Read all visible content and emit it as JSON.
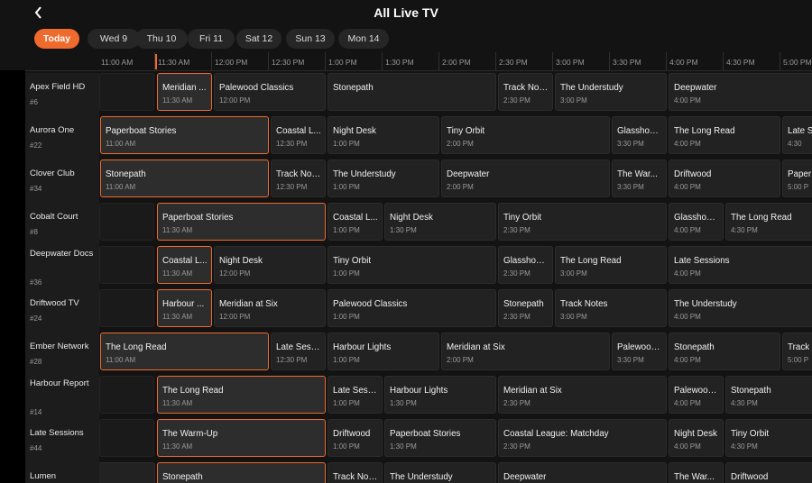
{
  "header": {
    "title": "All Live TV",
    "back_icon": "chevron-left-icon"
  },
  "days": [
    "Today",
    "Wed 9",
    "Thu 10",
    "Fri 11",
    "Sat 12",
    "Sun 13",
    "Mon 14"
  ],
  "timeline": [
    "11:00 AM",
    "11:30 AM",
    "12:00 PM",
    "12:30 PM",
    "1:00 PM",
    "1:30 PM",
    "2:00 PM",
    "2:30 PM",
    "3:00 PM",
    "3:30 PM",
    "4:00 PM",
    "4:30 PM",
    "5:00 PM"
  ],
  "accent_color": "#ee6a2d",
  "channels": [
    {
      "name": "Apex Field HD",
      "number": "#6",
      "programs": [
        {
          "title": "Meridian ...",
          "time": "11:30 AM",
          "live": true
        },
        {
          "title": "Palewood Classics",
          "time": "12:00 PM"
        },
        {
          "title": "Stonepath",
          "time": ""
        },
        {
          "title": "Track Not...",
          "time": "2:30 PM"
        },
        {
          "title": "The Understudy",
          "time": "3:00 PM"
        },
        {
          "title": "Deepwater",
          "time": "4:00 PM"
        }
      ]
    },
    {
      "name": "Aurora One",
      "number": "#22",
      "programs": [
        {
          "title": "Paperboat Stories",
          "time": "11:00 AM",
          "live": true
        },
        {
          "title": "Coastal L...",
          "time": "12:30 PM"
        },
        {
          "title": "Night Desk",
          "time": "1:00 PM"
        },
        {
          "title": "Tiny Orbit",
          "time": "2:00 PM"
        },
        {
          "title": "Glasshouse",
          "time": "3:30 PM"
        },
        {
          "title": "The Long Read",
          "time": "4:00 PM"
        },
        {
          "title": "Late S",
          "time": "4:30"
        }
      ]
    },
    {
      "name": "Clover Club",
      "number": "#34",
      "programs": [
        {
          "title": "Stonepath",
          "time": "11:00 AM",
          "live": true
        },
        {
          "title": "Track Not...",
          "time": "12:30 PM"
        },
        {
          "title": "The Understudy",
          "time": "1:00 PM"
        },
        {
          "title": "Deepwater",
          "time": "2:00 PM"
        },
        {
          "title": "The War...",
          "time": "3:30 PM"
        },
        {
          "title": "Driftwood",
          "time": "4:00 PM"
        },
        {
          "title": "Paper",
          "time": "5:00 P"
        }
      ]
    },
    {
      "name": "Cobalt Court",
      "number": "#8",
      "programs": [
        {
          "title": "Paperboat Stories",
          "time": "11:30 AM",
          "live": true
        },
        {
          "title": "Coastal L...",
          "time": "1:00 PM"
        },
        {
          "title": "Night Desk",
          "time": "1:30 PM"
        },
        {
          "title": "Tiny Orbit",
          "time": "2:30 PM"
        },
        {
          "title": "Glasshouse",
          "time": "4:00 PM"
        },
        {
          "title": "The Long Read",
          "time": "4:30 PM"
        }
      ]
    },
    {
      "name": "Deepwater Docs",
      "number": "#36",
      "programs": [
        {
          "title": "Coastal L...",
          "time": "11:30 AM",
          "live": true
        },
        {
          "title": "Night Desk",
          "time": "12:00 PM"
        },
        {
          "title": "Tiny Orbit",
          "time": "1:00 PM"
        },
        {
          "title": "Glasshouse",
          "time": "2:30 PM"
        },
        {
          "title": "The Long Read",
          "time": "3:00 PM"
        },
        {
          "title": "Late Sessions",
          "time": "4:00 PM"
        }
      ]
    },
    {
      "name": "Driftwood TV",
      "number": "#24",
      "programs": [
        {
          "title": "Harbour ...",
          "time": "11:30 AM",
          "live": true
        },
        {
          "title": "Meridian at Six",
          "time": "12:00 PM"
        },
        {
          "title": "Palewood Classics",
          "time": "1:00 PM"
        },
        {
          "title": "Stonepath",
          "time": "2:30 PM"
        },
        {
          "title": "Track Notes",
          "time": "3:00 PM"
        },
        {
          "title": "The Understudy",
          "time": "4:00 PM"
        }
      ]
    },
    {
      "name": "Ember Network",
      "number": "#28",
      "programs": [
        {
          "title": "The Long Read",
          "time": "11:00 AM",
          "live": true
        },
        {
          "title": "Late Sess...",
          "time": "12:30 PM"
        },
        {
          "title": "Harbour Lights",
          "time": "1:00 PM"
        },
        {
          "title": "Meridian at Six",
          "time": "2:00 PM"
        },
        {
          "title": "Palewood...",
          "time": "3:30 PM"
        },
        {
          "title": "Stonepath",
          "time": "4:00 PM"
        },
        {
          "title": "Track",
          "time": "5:00 P"
        }
      ]
    },
    {
      "name": "Harbour Report",
      "number": "#14",
      "programs": [
        {
          "title": "The Long Read",
          "time": "11:30 AM",
          "live": true
        },
        {
          "title": "Late Sess...",
          "time": "1:00 PM"
        },
        {
          "title": "Harbour Lights",
          "time": "1:30 PM"
        },
        {
          "title": "Meridian at Six",
          "time": "2:30 PM"
        },
        {
          "title": "Palewood...",
          "time": "4:00 PM"
        },
        {
          "title": "Stonepath",
          "time": "4:30 PM"
        }
      ]
    },
    {
      "name": "Late Sessions",
      "number": "#44",
      "programs": [
        {
          "title": "The Warm-Up",
          "time": "11:30 AM",
          "live": true
        },
        {
          "title": "Driftwood",
          "time": "1:00 PM"
        },
        {
          "title": "Paperboat Stories",
          "time": "1:30 PM"
        },
        {
          "title": "Coastal League: Matchday",
          "time": "2:30 PM"
        },
        {
          "title": "Night Desk",
          "time": "4:00 PM"
        },
        {
          "title": "Tiny Orbit",
          "time": "4:30 PM"
        }
      ]
    },
    {
      "name": "Lumen",
      "number": "",
      "programs": [
        {
          "title": "assics",
          "time": ""
        },
        {
          "title": "Stonepath",
          "time": "",
          "live": true
        },
        {
          "title": "Track Not...",
          "time": ""
        },
        {
          "title": "The Understudy",
          "time": ""
        },
        {
          "title": "Deepwater",
          "time": ""
        },
        {
          "title": "The War...",
          "time": ""
        },
        {
          "title": "Driftwood",
          "time": ""
        }
      ]
    }
  ]
}
